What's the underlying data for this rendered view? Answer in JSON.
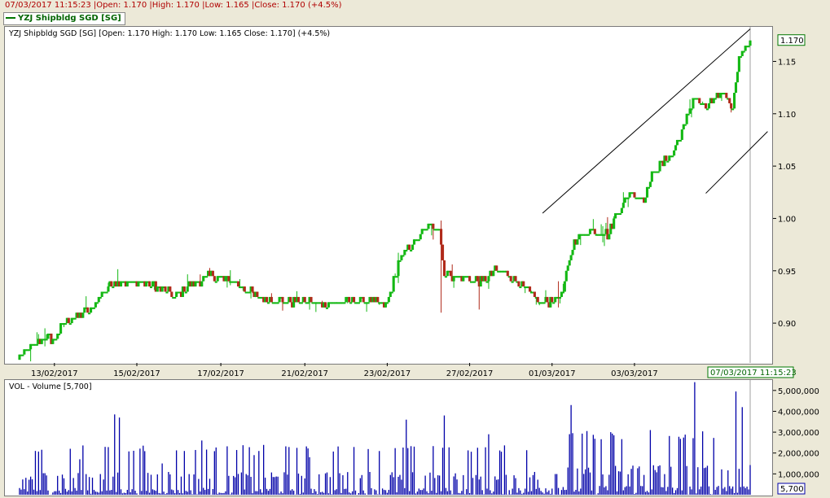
{
  "header": {
    "datetime": "07/03/2017 11:15:23",
    "open": "|Open: 1.170",
    "high": "|High: 1.170",
    "low": "|Low: 1.165",
    "close": "|Close: 1.170 (+4.5%)"
  },
  "legend": {
    "label": "YZJ Shipbldg SGD [SG]",
    "line_color": "#007700"
  },
  "price_panel": {
    "title": "YZJ Shipbldg SGD [SG] [Open: 1.170  High: 1.170  Low: 1.165  Close: 1.170] (+4.5%)",
    "last_price_tag": "1.170",
    "time_tag": "07/03/2017 11:15:23"
  },
  "volume_panel": {
    "title": "VOL - Volume [5,700]",
    "last_volume_tag": "5,700"
  },
  "colors": {
    "up": "#14b814",
    "down": "#b02a1a",
    "volume": "#0000a8",
    "trendline": "#000000",
    "cursor_line": "#a0a0a0"
  },
  "chart_data": [
    {
      "type": "candlestick",
      "x_tick_labels": [
        "13/02/2017",
        "15/02/2017",
        "17/02/2017",
        "21/02/2017",
        "23/02/2017",
        "27/02/2017",
        "01/03/2017",
        "03/03/2017"
      ],
      "y_tick_labels": [
        "0.90",
        "0.95",
        "1.00",
        "1.05",
        "1.10",
        "1.15"
      ],
      "ylim": [
        0.862,
        1.183
      ],
      "close_path": [
        {
          "i": 0,
          "v": 0.868
        },
        {
          "i": 14,
          "v": 0.885
        },
        {
          "i": 22,
          "v": 0.885
        },
        {
          "i": 28,
          "v": 0.902
        },
        {
          "i": 45,
          "v": 0.912
        },
        {
          "i": 53,
          "v": 0.93
        },
        {
          "i": 60,
          "v": 0.94
        },
        {
          "i": 85,
          "v": 0.937
        },
        {
          "i": 98,
          "v": 0.925
        },
        {
          "i": 106,
          "v": 0.935
        },
        {
          "i": 120,
          "v": 0.945
        },
        {
          "i": 135,
          "v": 0.94
        },
        {
          "i": 150,
          "v": 0.925
        },
        {
          "i": 168,
          "v": 0.92
        },
        {
          "i": 190,
          "v": 0.92
        },
        {
          "i": 215,
          "v": 0.922
        },
        {
          "i": 232,
          "v": 0.918
        },
        {
          "i": 240,
          "v": 0.962
        },
        {
          "i": 248,
          "v": 0.975
        },
        {
          "i": 256,
          "v": 0.99
        },
        {
          "i": 262,
          "v": 0.995
        },
        {
          "i": 265,
          "v": 0.99
        },
        {
          "i": 268,
          "v": 0.948
        },
        {
          "i": 275,
          "v": 0.945
        },
        {
          "i": 292,
          "v": 0.94
        },
        {
          "i": 300,
          "v": 0.95
        },
        {
          "i": 306,
          "v": 0.95
        },
        {
          "i": 318,
          "v": 0.935
        },
        {
          "i": 328,
          "v": 0.92
        },
        {
          "i": 338,
          "v": 0.922
        },
        {
          "i": 343,
          "v": 0.93
        },
        {
          "i": 350,
          "v": 0.98
        },
        {
          "i": 360,
          "v": 0.988
        },
        {
          "i": 372,
          "v": 0.985
        },
        {
          "i": 376,
          "v": 1.002
        },
        {
          "i": 386,
          "v": 1.025
        },
        {
          "i": 394,
          "v": 1.02
        },
        {
          "i": 400,
          "v": 1.045
        },
        {
          "i": 412,
          "v": 1.062
        },
        {
          "i": 420,
          "v": 1.09
        },
        {
          "i": 426,
          "v": 1.118
        },
        {
          "i": 432,
          "v": 1.105
        },
        {
          "i": 444,
          "v": 1.12
        },
        {
          "i": 450,
          "v": 1.108
        },
        {
          "i": 454,
          "v": 1.155
        },
        {
          "i": 461,
          "v": 1.17
        }
      ],
      "bar_count": 462,
      "trendlines": [
        {
          "from": {
            "i": 330,
            "v": 1.005
          },
          "to": {
            "i": 461,
            "v": 1.181
          }
        },
        {
          "from": {
            "i": 433,
            "v": 1.024
          },
          "to": {
            "i": 472,
            "v": 1.083
          }
        }
      ]
    },
    {
      "type": "bar",
      "series_label": "VOL - Volume",
      "y_tick_labels": [
        "1,000,000",
        "2,000,000",
        "3,000,000",
        "4,000,000",
        "5,000,000"
      ],
      "ylim": [
        0,
        5500000
      ],
      "spikes": [
        {
          "i": 10,
          "v": 2100000
        },
        {
          "i": 38,
          "v": 1700000
        },
        {
          "i": 60,
          "v": 3850000
        },
        {
          "i": 63,
          "v": 3700000
        },
        {
          "i": 90,
          "v": 1500000
        },
        {
          "i": 115,
          "v": 2600000
        },
        {
          "i": 148,
          "v": 1900000
        },
        {
          "i": 183,
          "v": 1800000
        },
        {
          "i": 244,
          "v": 3600000
        },
        {
          "i": 268,
          "v": 3800000
        },
        {
          "i": 296,
          "v": 2900000
        },
        {
          "i": 348,
          "v": 4300000
        },
        {
          "i": 373,
          "v": 3000000
        },
        {
          "i": 398,
          "v": 3100000
        },
        {
          "i": 426,
          "v": 5400000
        },
        {
          "i": 452,
          "v": 4950000
        },
        {
          "i": 456,
          "v": 4200000
        }
      ],
      "last_value": 5700
    }
  ]
}
